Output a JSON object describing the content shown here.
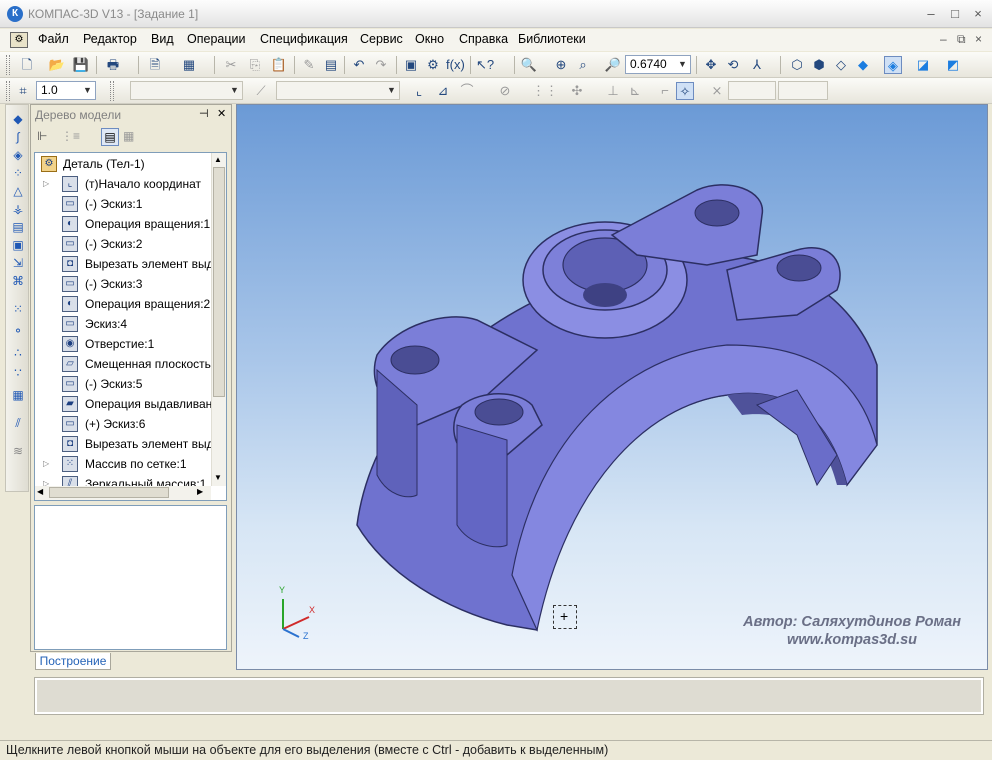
{
  "window": {
    "title": "КОМПАС-3D V13 - [Задание 1]",
    "app_icon": "К",
    "controls": [
      "–",
      "□",
      "×"
    ],
    "doc_controls": [
      "–",
      "⧉",
      "×"
    ]
  },
  "menu": {
    "items": [
      "Файл",
      "Редактор",
      "Вид",
      "Операции",
      "Спецификация",
      "Сервис",
      "Окно",
      "Справка",
      "Библиотеки"
    ]
  },
  "toolbar": {
    "zoom_value": "0.6740"
  },
  "toolbar2": {
    "step_value": "1.0"
  },
  "tree": {
    "title": "Дерево модели",
    "pin": "⊣",
    "close": "✕",
    "root": "Деталь (Тел-1)",
    "items": [
      {
        "label": "(т)Начало координат",
        "icon": "axis-icon"
      },
      {
        "label": "(-) Эскиз:1",
        "icon": "sketch-icon"
      },
      {
        "label": "Операция вращения:1",
        "icon": "revolve-icon"
      },
      {
        "label": "(-) Эскиз:2",
        "icon": "sketch-icon"
      },
      {
        "label": "Вырезать элемент выдавливания",
        "icon": "cut-icon"
      },
      {
        "label": "(-) Эскиз:3",
        "icon": "sketch-icon"
      },
      {
        "label": "Операция вращения:2",
        "icon": "revolve-icon"
      },
      {
        "label": "Эскиз:4",
        "icon": "sketch-icon"
      },
      {
        "label": "Отверстие:1",
        "icon": "hole-icon"
      },
      {
        "label": "Смещенная плоскость",
        "icon": "plane-icon"
      },
      {
        "label": "(-) Эскиз:5",
        "icon": "sketch-icon"
      },
      {
        "label": "Операция выдавливания",
        "icon": "extrude-icon"
      },
      {
        "label": "(+) Эскиз:6",
        "icon": "sketch-icon"
      },
      {
        "label": "Вырезать элемент выдавливания",
        "icon": "cut-icon"
      },
      {
        "label": "Массив по сетке:1",
        "icon": "array-icon"
      },
      {
        "label": "Зеркальный массив:1",
        "icon": "mirror-icon"
      }
    ],
    "tab_label": "Построение"
  },
  "viewport": {
    "author_line1": "Автор: Саляхутдинов Роман",
    "author_line2": "www.kompas3d.su",
    "axis_labels": {
      "x": "X",
      "y": "Y",
      "z": "Z"
    },
    "model_color": "#7b7fd6"
  },
  "status": {
    "text": "Щелкните левой кнопкой мыши на объекте для его выделения (вместе с Ctrl - добавить к выделенным)"
  }
}
